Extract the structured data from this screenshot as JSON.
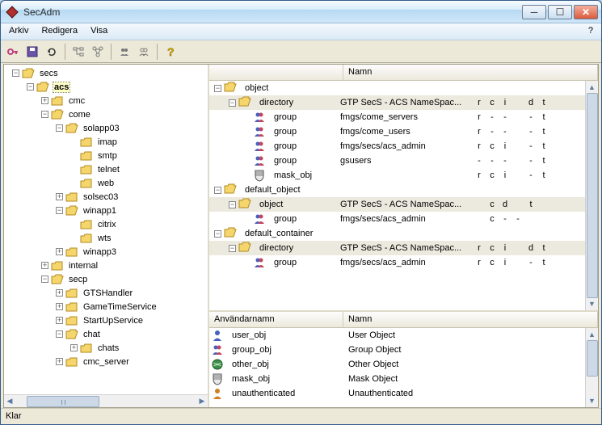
{
  "window": {
    "title": "SecAdm"
  },
  "menu": {
    "arkiv": "Arkiv",
    "redigera": "Redigera",
    "visa": "Visa",
    "help": "?"
  },
  "tree": {
    "root": "secs",
    "items": [
      {
        "label": "acs",
        "depth": 1,
        "exp": "-",
        "folder": "open",
        "bold": true
      },
      {
        "label": "cmc",
        "depth": 2,
        "exp": "+",
        "folder": "closed"
      },
      {
        "label": "come",
        "depth": 2,
        "exp": "-",
        "folder": "open"
      },
      {
        "label": "solapp03",
        "depth": 3,
        "exp": "-",
        "folder": "open"
      },
      {
        "label": "imap",
        "depth": 4,
        "exp": " ",
        "folder": "closed"
      },
      {
        "label": "smtp",
        "depth": 4,
        "exp": " ",
        "folder": "closed"
      },
      {
        "label": "telnet",
        "depth": 4,
        "exp": " ",
        "folder": "closed"
      },
      {
        "label": "web",
        "depth": 4,
        "exp": " ",
        "folder": "closed"
      },
      {
        "label": "solsec03",
        "depth": 3,
        "exp": "+",
        "folder": "closed"
      },
      {
        "label": "winapp1",
        "depth": 3,
        "exp": "-",
        "folder": "open"
      },
      {
        "label": "citrix",
        "depth": 4,
        "exp": " ",
        "folder": "closed"
      },
      {
        "label": "wts",
        "depth": 4,
        "exp": " ",
        "folder": "closed"
      },
      {
        "label": "winapp3",
        "depth": 3,
        "exp": "+",
        "folder": "closed"
      },
      {
        "label": "internal",
        "depth": 2,
        "exp": "+",
        "folder": "closed"
      },
      {
        "label": "secp",
        "depth": 2,
        "exp": "-",
        "folder": "open"
      },
      {
        "label": "GTSHandler",
        "depth": 3,
        "exp": "+",
        "folder": "closed"
      },
      {
        "label": "GameTimeService",
        "depth": 3,
        "exp": "+",
        "folder": "closed"
      },
      {
        "label": "StartUpService",
        "depth": 3,
        "exp": "+",
        "folder": "closed"
      },
      {
        "label": "chat",
        "depth": 3,
        "exp": "-",
        "folder": "open"
      },
      {
        "label": "chats",
        "depth": 4,
        "exp": "+",
        "folder": "closed"
      },
      {
        "label": "cmc_server",
        "depth": 3,
        "exp": "+",
        "folder": "closed"
      }
    ]
  },
  "detailHeader": {
    "blank": " ",
    "namn": "Namn"
  },
  "detail": [
    {
      "type": "object",
      "exp": "-",
      "icon": "folder",
      "label": "object",
      "shaded": false,
      "depth": 0
    },
    {
      "type": "dir",
      "exp": "-",
      "icon": "folder",
      "label": "directory",
      "name": "GTP SecS - ACS NameSpac...",
      "perms": [
        "r",
        "c",
        "i",
        "",
        "d",
        "t"
      ],
      "shaded": true,
      "depth": 1
    },
    {
      "type": "group",
      "icon": "group",
      "label": "group",
      "name": "fmgs/come_servers",
      "perms": [
        "r",
        "-",
        "-",
        "",
        "-",
        "t"
      ],
      "shaded": false,
      "depth": 2
    },
    {
      "type": "group",
      "icon": "group",
      "label": "group",
      "name": "fmgs/come_users",
      "perms": [
        "r",
        "-",
        "-",
        "",
        "-",
        "t"
      ],
      "shaded": false,
      "depth": 2
    },
    {
      "type": "group",
      "icon": "group",
      "label": "group",
      "name": "fmgs/secs/acs_admin",
      "perms": [
        "r",
        "c",
        "i",
        "",
        "-",
        "t"
      ],
      "shaded": false,
      "depth": 2
    },
    {
      "type": "group",
      "icon": "group",
      "label": "group",
      "name": "gsusers",
      "perms": [
        "-",
        "-",
        "-",
        "",
        "-",
        "t"
      ],
      "shaded": false,
      "depth": 2
    },
    {
      "type": "mask",
      "icon": "mask",
      "label": "mask_obj",
      "name": "",
      "perms": [
        "r",
        "c",
        "i",
        "",
        "-",
        "t"
      ],
      "shaded": false,
      "depth": 2
    },
    {
      "type": "object",
      "exp": "-",
      "icon": "folder",
      "label": "default_object",
      "shaded": false,
      "depth": 0
    },
    {
      "type": "dir",
      "exp": "-",
      "icon": "folder",
      "label": "object",
      "name": "GTP SecS - ACS NameSpac...",
      "perms": [
        "",
        "c",
        "d",
        "",
        "t",
        ""
      ],
      "shaded": true,
      "depth": 1
    },
    {
      "type": "group",
      "icon": "group",
      "label": "group",
      "name": "fmgs/secs/acs_admin",
      "perms": [
        "",
        "c",
        "-",
        "-",
        "",
        ""
      ],
      "shaded": false,
      "depth": 2
    },
    {
      "type": "object",
      "exp": "-",
      "icon": "folder",
      "label": "default_container",
      "shaded": false,
      "depth": 0
    },
    {
      "type": "dir",
      "exp": "-",
      "icon": "folder",
      "label": "directory",
      "name": "GTP SecS - ACS NameSpac...",
      "perms": [
        "r",
        "c",
        "i",
        "",
        "d",
        "t"
      ],
      "shaded": true,
      "depth": 1
    },
    {
      "type": "group",
      "icon": "group",
      "label": "group",
      "name": "fmgs/secs/acs_admin",
      "perms": [
        "r",
        "c",
        "i",
        "",
        "-",
        "t"
      ],
      "shaded": false,
      "depth": 2
    }
  ],
  "bottomHeader": {
    "user": "Användarnamn",
    "namn": "Namn"
  },
  "bottom": [
    {
      "icon": "user",
      "user": "user_obj",
      "namn": "User Object"
    },
    {
      "icon": "group",
      "user": "group_obj",
      "namn": "Group Object"
    },
    {
      "icon": "other",
      "user": "other_obj",
      "namn": "Other Object"
    },
    {
      "icon": "mask",
      "user": "mask_obj",
      "namn": "Mask Object"
    },
    {
      "icon": "unauth",
      "user": "unauthenticated",
      "namn": "Unauthenticated"
    }
  ],
  "status": {
    "text": "Klar"
  }
}
